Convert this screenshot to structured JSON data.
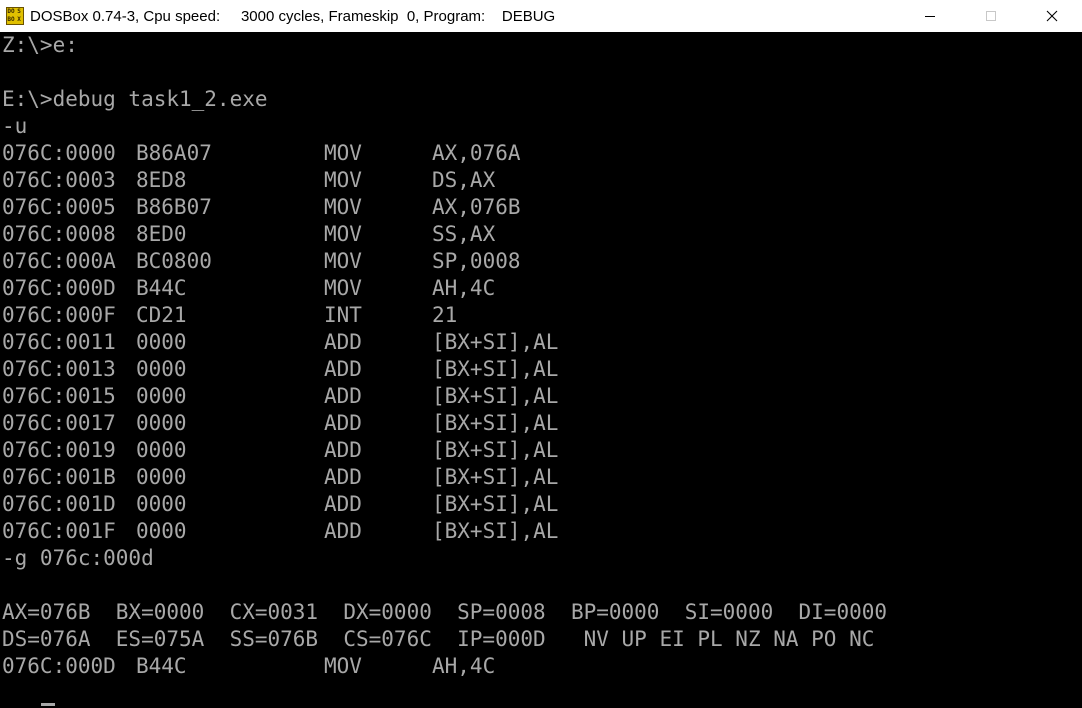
{
  "window": {
    "title": "DOSBox 0.74-3, Cpu speed:     3000 cycles, Frameskip  0, Program:    DEBUG",
    "icon_letters": [
      "DO",
      "S",
      "BO",
      "X"
    ]
  },
  "console": {
    "prompt_lines": {
      "line1": "Z:\\>e:",
      "line2": "E:\\>debug task1_2.exe",
      "line3": "-u"
    },
    "disasm": [
      {
        "addr": "076C:0000",
        "bytes": "B86A07",
        "mnemonic": "MOV",
        "operands": "AX,076A"
      },
      {
        "addr": "076C:0003",
        "bytes": "8ED8",
        "mnemonic": "MOV",
        "operands": "DS,AX"
      },
      {
        "addr": "076C:0005",
        "bytes": "B86B07",
        "mnemonic": "MOV",
        "operands": "AX,076B"
      },
      {
        "addr": "076C:0008",
        "bytes": "8ED0",
        "mnemonic": "MOV",
        "operands": "SS,AX"
      },
      {
        "addr": "076C:000A",
        "bytes": "BC0800",
        "mnemonic": "MOV",
        "operands": "SP,0008"
      },
      {
        "addr": "076C:000D",
        "bytes": "B44C",
        "mnemonic": "MOV",
        "operands": "AH,4C"
      },
      {
        "addr": "076C:000F",
        "bytes": "CD21",
        "mnemonic": "INT",
        "operands": "21"
      },
      {
        "addr": "076C:0011",
        "bytes": "0000",
        "mnemonic": "ADD",
        "operands": "[BX+SI],AL"
      },
      {
        "addr": "076C:0013",
        "bytes": "0000",
        "mnemonic": "ADD",
        "operands": "[BX+SI],AL"
      },
      {
        "addr": "076C:0015",
        "bytes": "0000",
        "mnemonic": "ADD",
        "operands": "[BX+SI],AL"
      },
      {
        "addr": "076C:0017",
        "bytes": "0000",
        "mnemonic": "ADD",
        "operands": "[BX+SI],AL"
      },
      {
        "addr": "076C:0019",
        "bytes": "0000",
        "mnemonic": "ADD",
        "operands": "[BX+SI],AL"
      },
      {
        "addr": "076C:001B",
        "bytes": "0000",
        "mnemonic": "ADD",
        "operands": "[BX+SI],AL"
      },
      {
        "addr": "076C:001D",
        "bytes": "0000",
        "mnemonic": "ADD",
        "operands": "[BX+SI],AL"
      },
      {
        "addr": "076C:001F",
        "bytes": "0000",
        "mnemonic": "ADD",
        "operands": "[BX+SI],AL"
      }
    ],
    "go_command": "-g 076c:000d",
    "registers_line1": "AX=076B  BX=0000  CX=0031  DX=0000  SP=0008  BP=0000  SI=0000  DI=0000",
    "registers_line2": "DS=076A  ES=075A  SS=076B  CS=076C  IP=000D   NV UP EI PL NZ NA PO NC",
    "current_instruction": {
      "addr": "076C:000D",
      "bytes": "B44C",
      "mnemonic": "MOV",
      "operands": "AH,4C"
    },
    "input_prompt": "- ▲"
  }
}
